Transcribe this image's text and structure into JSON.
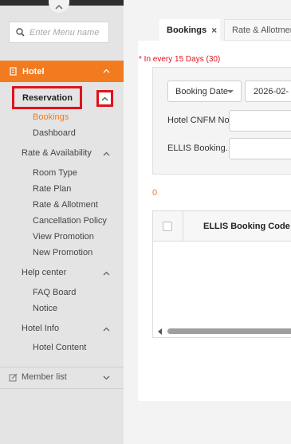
{
  "sidebar": {
    "search_placeholder": "Enter Menu name",
    "section": "Hotel",
    "reservation": {
      "label": "Reservation",
      "items": [
        "Bookings",
        "Dashboard"
      ],
      "active_item": "Bookings"
    },
    "rate_availability": {
      "label": "Rate & Availability",
      "items": [
        "Room Type",
        "Rate Plan",
        "Rate & Allotment",
        "Cancellation Policy",
        "View Promotion",
        "New Promotion"
      ]
    },
    "help_center": {
      "label": "Help center",
      "items": [
        "FAQ Board",
        "Notice"
      ]
    },
    "hotel_info": {
      "label": "Hotel Info",
      "items": [
        "Hotel Content"
      ]
    },
    "member_list": "Member list"
  },
  "tabs": {
    "bookings": "Bookings",
    "close_glyph": "×",
    "rate_allotment": "Rate & Allotment"
  },
  "filter": {
    "hint": "* In every 15 Days (30)",
    "date_type": "Booking Date",
    "date_value": "2026-02-",
    "cnfm_label": "Hotel CNFM No.",
    "ellis_label": "ELLIS Booking..."
  },
  "results": {
    "count": "0",
    "columns": [
      "ELLIS Booking Code"
    ]
  },
  "colors": {
    "accent": "#f27a1f",
    "highlight": "#e0121d"
  }
}
